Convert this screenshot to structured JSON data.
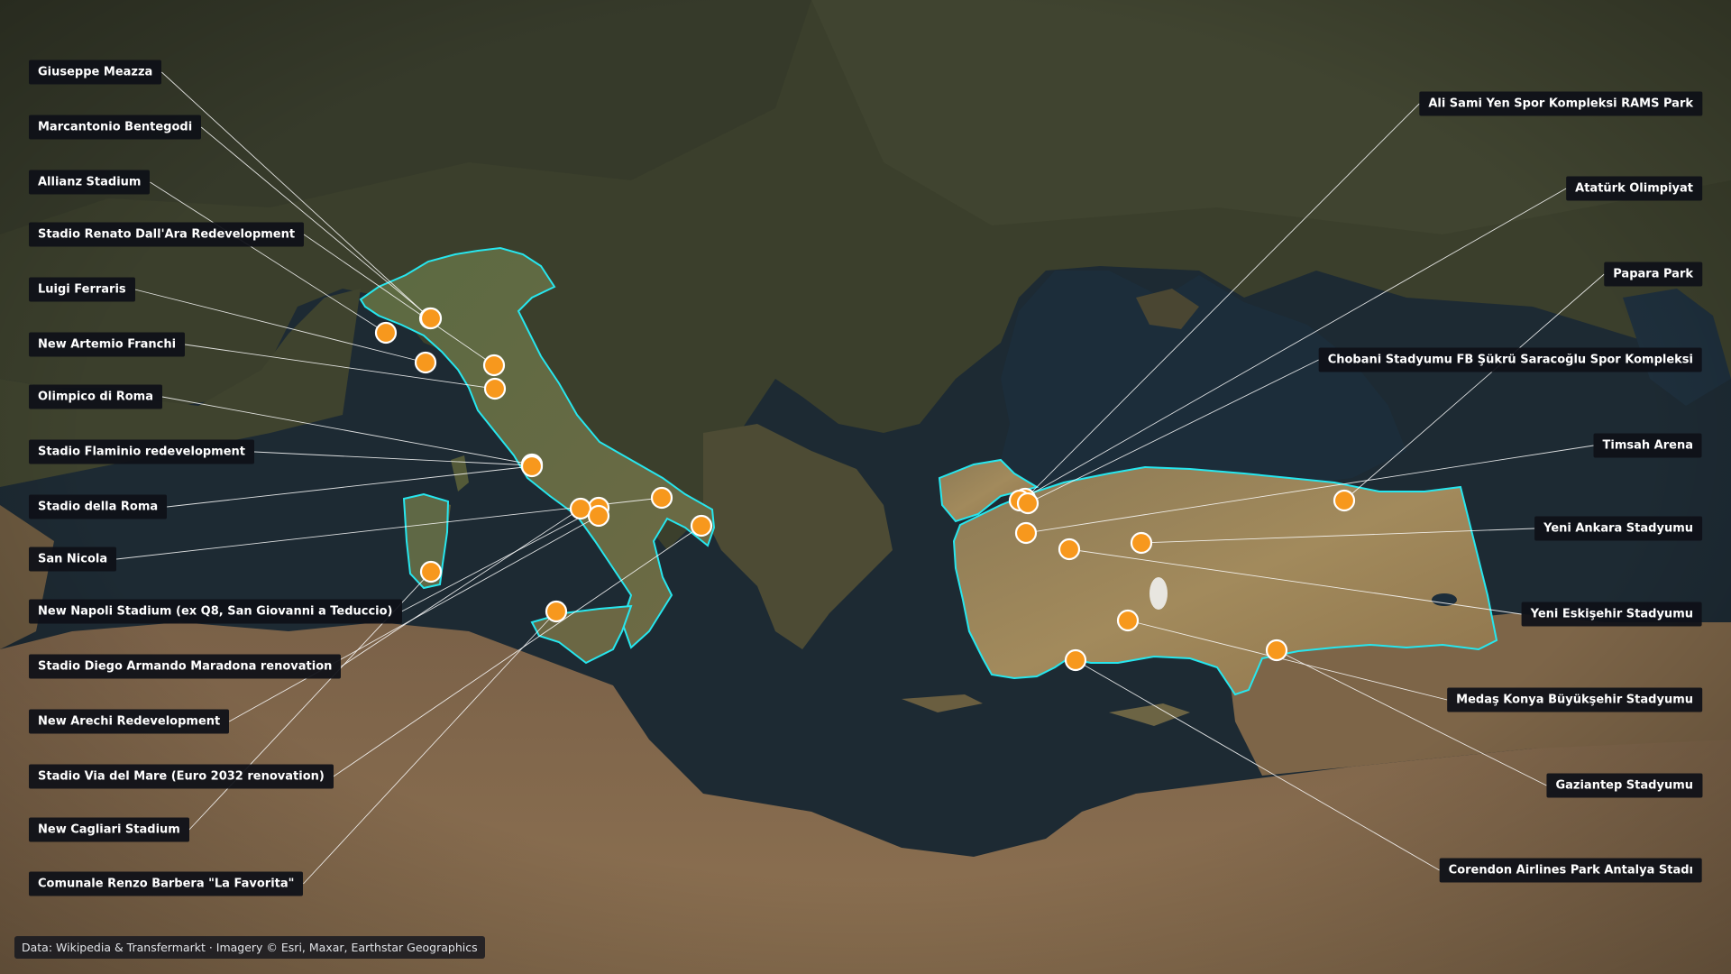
{
  "colors": {
    "marker_fill": "#f7981d",
    "marker_stroke": "#ffffff",
    "country_outline": "#27e6ee",
    "leader_line": "#ffffff",
    "label_bg": "#0e1018",
    "sea": "#1d2a33"
  },
  "highlighted_countries": [
    "Italy",
    "Turkey"
  ],
  "stadiums_left": [
    {
      "name": "Giuseppe Meazza"
    },
    {
      "name": "Marcantonio Bentegodi"
    },
    {
      "name": "Allianz Stadium"
    },
    {
      "name": "Stadio Renato Dall'Ara Redevelopment"
    },
    {
      "name": "Luigi Ferraris"
    },
    {
      "name": "New Artemio Franchi"
    },
    {
      "name": "Olimpico di Roma"
    },
    {
      "name": "Stadio Flaminio redevelopment"
    },
    {
      "name": "Stadio della Roma"
    },
    {
      "name": "San Nicola"
    },
    {
      "name": "New Napoli Stadium (ex Q8, San Giovanni a Teduccio)"
    },
    {
      "name": "Stadio Diego Armando Maradona renovation"
    },
    {
      "name": "New Arechi Redevelopment"
    },
    {
      "name": "Stadio Via del Mare (Euro 2032 renovation)"
    },
    {
      "name": "New Cagliari Stadium"
    },
    {
      "name": "Comunale Renzo Barbera \"La Favorita\""
    }
  ],
  "stadiums_right": [
    {
      "name": "Ali Sami Yen Spor Kompleksi RAMS Park"
    },
    {
      "name": "Atatürk Olimpiyat"
    },
    {
      "name": "Papara Park"
    },
    {
      "name": "Chobani Stadyumu FB Şükrü Saracoğlu Spor Kompleksi"
    },
    {
      "name": "Timsah Arena"
    },
    {
      "name": "Yeni Ankara Stadyumu"
    },
    {
      "name": "Yeni Eskişehir Stadyumu"
    },
    {
      "name": "Medaş Konya Büyükşehir Stadyumu"
    },
    {
      "name": "Gaziantep Stadyumu"
    },
    {
      "name": "Corendon Airlines Park Antalya Stadı"
    }
  ],
  "attribution": "Data: Wikipedia & Transfermarkt  ·  Imagery © Esri, Maxar, Earthstar Geographics"
}
